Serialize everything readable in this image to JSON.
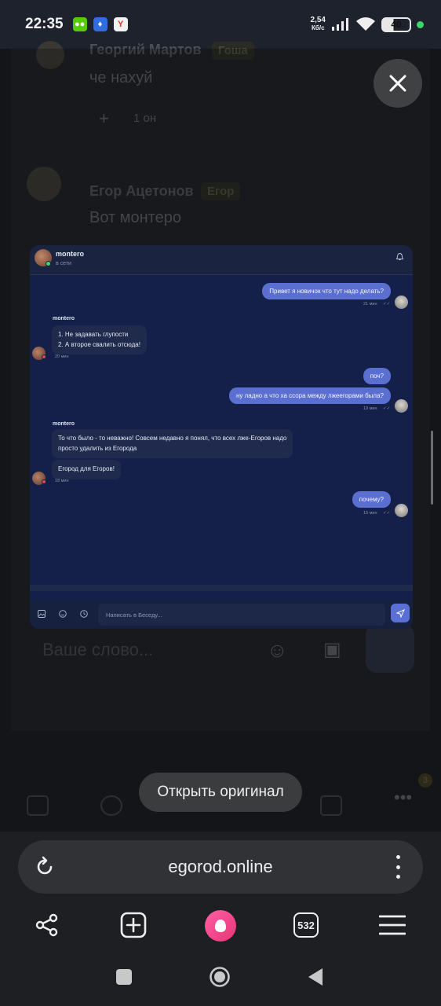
{
  "status_bar": {
    "time": "22:35",
    "net_speed_value": "2,54",
    "net_speed_unit": "Кб/с",
    "battery": "40",
    "apps": [
      "duolingo-icon",
      "a-app-icon",
      "yandex-icon"
    ]
  },
  "background_chat": {
    "message1": {
      "author": "Георгий Мартов",
      "tag": "Гоша",
      "text": "че нахуй",
      "reaction": "1 он"
    },
    "message2": {
      "author": "Егор Ацетонов",
      "tag": "Егор",
      "text": "Вот монтеро"
    },
    "input_placeholder": "Ваше слово..."
  },
  "preview": {
    "header": {
      "name": "montero",
      "status": "в сети"
    },
    "messages": [
      {
        "side": "out",
        "text": "Привет я новичок что тут надо делать?",
        "time": "21 мин"
      },
      {
        "side": "in",
        "author": "montero",
        "lines": [
          "1. Не задавать глупости",
          "2. А второе свалить отсюда!"
        ],
        "time": "20 мин"
      },
      {
        "side": "out",
        "text": "поч?"
      },
      {
        "side": "out",
        "text": "ну ладно а что ха ссора между лжеегорами была?",
        "time": "19 мин"
      },
      {
        "side": "in",
        "author": "montero",
        "lines": [
          "То что было - то неважно! Совсем недавно я понял, что всех лже-Егоров надо",
          "просто удалить из Егорода"
        ]
      },
      {
        "side": "in",
        "text": "Егород для Егоров!",
        "time": "18 мин"
      },
      {
        "side": "out",
        "text": "почему?",
        "time": "15 мин"
      }
    ],
    "input_placeholder": "Написать в Беседу..."
  },
  "open_original_label": "Открыть оригинал",
  "browser": {
    "url": "egorod.online",
    "tabs_count": "532",
    "nav_badge": "3"
  }
}
